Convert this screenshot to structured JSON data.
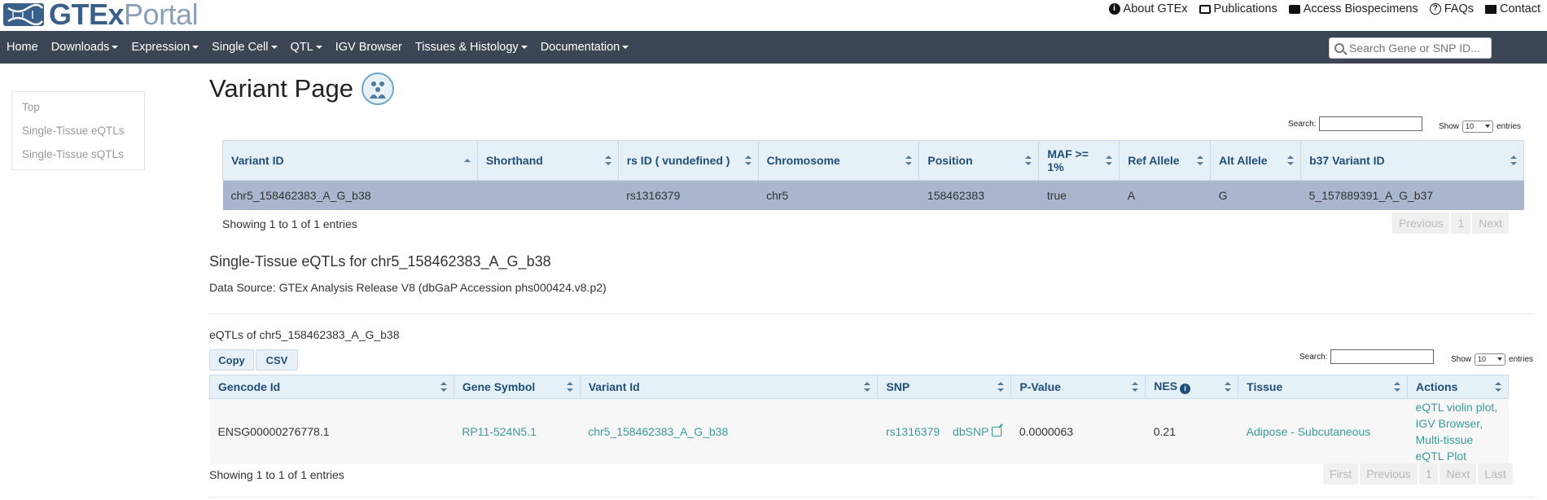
{
  "header": {
    "logo_gtex": "GTEx",
    "logo_portal": "Portal",
    "links": [
      "About GTEx",
      "Publications",
      "Access Biospecimens",
      "FAQs",
      "Contact"
    ]
  },
  "nav": {
    "items": [
      "Home",
      "Downloads",
      "Expression",
      "Single Cell",
      "QTL",
      "IGV Browser",
      "Tissues & Histology",
      "Documentation"
    ],
    "search_placeholder": "Search Gene or SNP ID..."
  },
  "sidebar": {
    "items": [
      "Top",
      "Single-Tissue eQTLs",
      "Single-Tissue sQTLs"
    ]
  },
  "page": {
    "title": "Variant Page"
  },
  "variant_table": {
    "search_label": "Search:",
    "show_label": "Show",
    "show_value": "10",
    "entries_label": "entries",
    "headers": [
      "Variant ID",
      "Shorthand",
      "rs ID ( vundefined )",
      "Chromosome",
      "Position",
      "MAF >= 1%",
      "Ref Allele",
      "Alt Allele",
      "b37 Variant ID"
    ],
    "row": [
      "chr5_158462383_A_G_b38",
      "",
      "rs1316379",
      "chr5",
      "158462383",
      "true",
      "A",
      "G",
      "5_157889391_A_G_b37"
    ],
    "info": "Showing 1 to 1 of 1 entries",
    "pager": [
      "Previous",
      "1",
      "Next"
    ]
  },
  "eqtl_section": {
    "heading": "Single-Tissue eQTLs for chr5_158462383_A_G_b38",
    "data_source": "Data Source: GTEx Analysis Release V8 (dbGaP Accession phs000424.v8.p2)",
    "subheading": "eQTLs of chr5_158462383_A_G_b38",
    "copy_label": "Copy",
    "csv_label": "CSV",
    "search_label": "Search:",
    "show_label": "Show",
    "show_value": "10",
    "entries_label": "entries",
    "headers": [
      "Gencode Id",
      "Gene Symbol",
      "Variant Id",
      "SNP",
      "P-Value",
      "NES",
      "Tissue",
      "Actions"
    ],
    "row": {
      "gencode_id": "ENSG00000276778.1",
      "gene_symbol": "RP11-524N5.1",
      "variant_id": "chr5_158462383_A_G_b38",
      "snp": "rs1316379",
      "dbsnp": "dbSNP",
      "p_value": "0.0000063",
      "nes": "0.21",
      "tissue": "Adipose - Subcutaneous",
      "actions": "eQTL violin plot, IGV Browser, Multi-tissue eQTL Plot"
    },
    "info": "Showing 1 to 1 of 1 entries",
    "pager": [
      "First",
      "Previous",
      "1",
      "Next",
      "Last"
    ]
  }
}
